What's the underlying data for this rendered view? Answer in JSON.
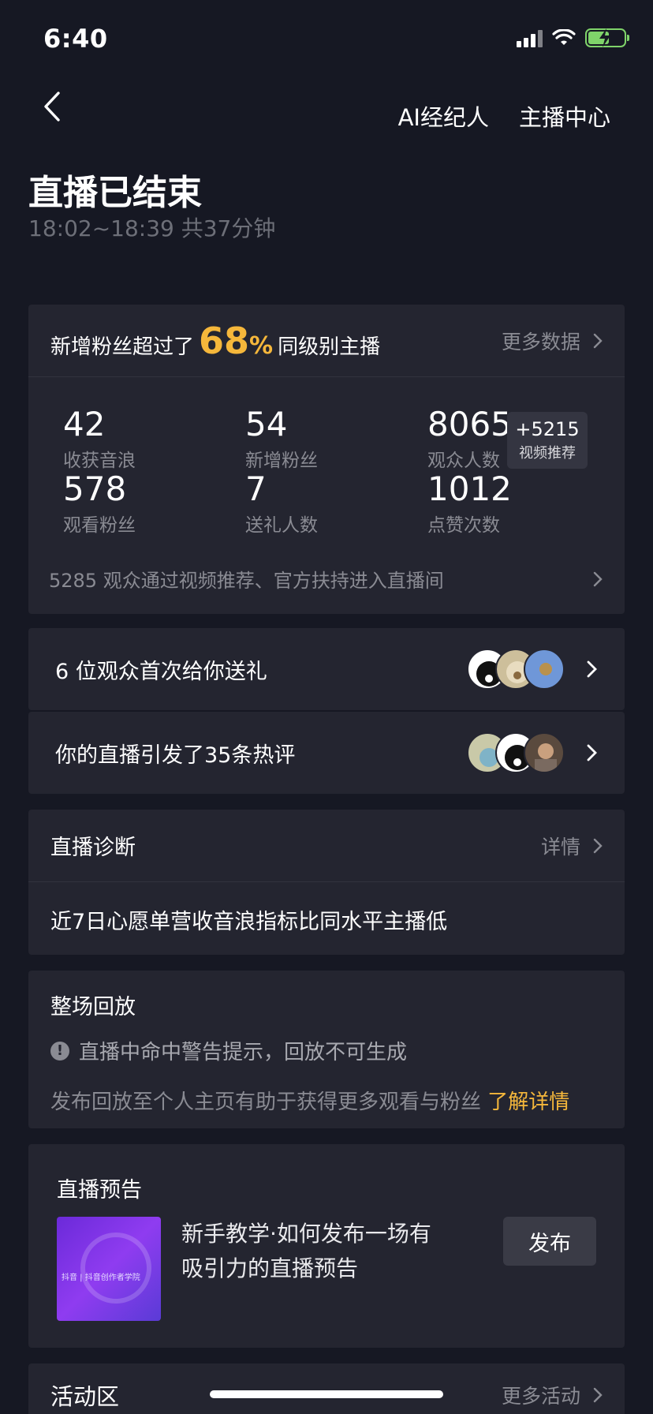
{
  "status_bar": {
    "time": "6:40"
  },
  "nav": {
    "ai_agent": "AI经纪人",
    "streamer_center": "主播中心"
  },
  "header": {
    "title": "直播已结束",
    "subtitle": "18:02~18:39 共37分钟"
  },
  "summary": {
    "prefix": "新增粉丝超过了",
    "percent": "68",
    "percent_sign": "%",
    "suffix": "同级别主播",
    "more": "更多数据",
    "stats": [
      {
        "value": "42",
        "label": "收获音浪"
      },
      {
        "value": "54",
        "label": "新增粉丝"
      },
      {
        "value": "8065",
        "label": "观众人数"
      },
      {
        "value": "578",
        "label": "观看粉丝"
      },
      {
        "value": "7",
        "label": "送礼人数"
      },
      {
        "value": "1012",
        "label": "点赞次数"
      }
    ],
    "badge": {
      "value": "+5215",
      "label": "视频推荐"
    },
    "footer": "5285 观众通过视频推荐、官方扶持进入直播间"
  },
  "gifts_row": {
    "text": "6 位观众首次给你送礼"
  },
  "comments_row": {
    "text": "你的直播引发了35条热评"
  },
  "diagnosis": {
    "title": "直播诊断",
    "detail": "详情",
    "body": "近7日心愿单营收音浪指标比同水平主播低"
  },
  "replay": {
    "title": "整场回放",
    "warning": "直播中命中警告提示，回放不可生成",
    "publish_hint": "发布回放至个人主页有助于获得更多观看与粉丝",
    "learn_more": "了解详情"
  },
  "preview": {
    "title": "直播预告",
    "thumb_label": "抖音 | 抖音创作者学院",
    "description": "新手教学·如何发布一场有吸引力的直播预告",
    "button": "发布"
  },
  "activity": {
    "title": "活动区",
    "more": "更多活动"
  },
  "colors": {
    "background": "#161823",
    "card": "#242530",
    "accent": "#f5b73b"
  }
}
